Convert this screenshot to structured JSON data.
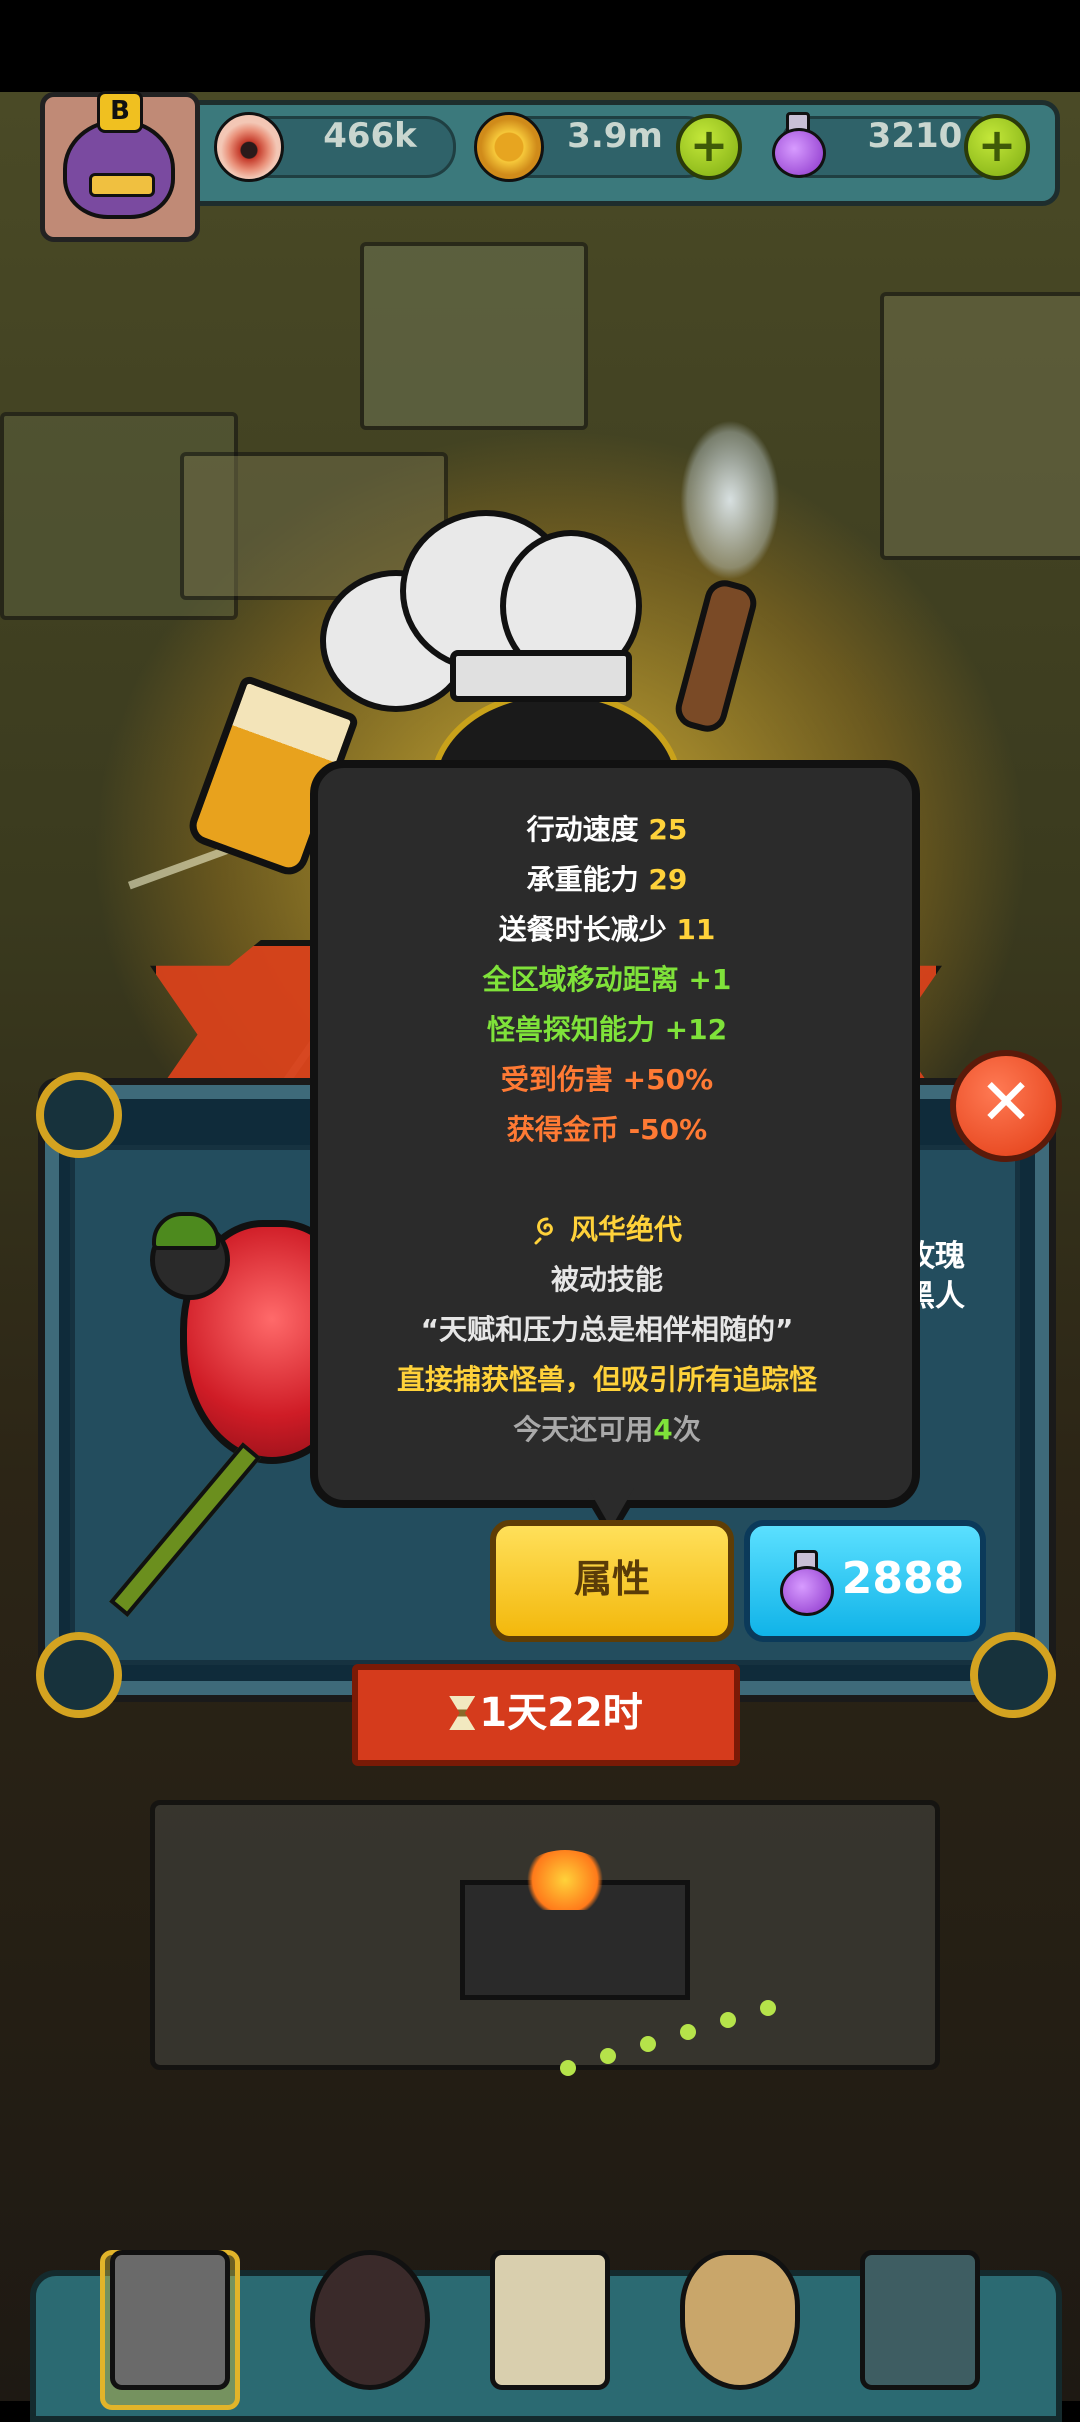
{
  "hud": {
    "eyeballs": "466k",
    "coins": "3.9m",
    "potions": "3210",
    "avatar_letter": "B",
    "plus_symbol": "+"
  },
  "popup": {
    "stats": [
      {
        "label": "行动速度",
        "value": "25"
      },
      {
        "label": "承重能力",
        "value": "29"
      },
      {
        "label": "送餐时长减少",
        "value": "11"
      }
    ],
    "bonuses": [
      {
        "label": "全区域移动距离",
        "value": "+1"
      },
      {
        "label": "怪兽探知能力",
        "value": "+12"
      }
    ],
    "penalties": [
      {
        "label": "受到伤害",
        "value": "+50%"
      },
      {
        "label": "获得金币",
        "value": "-50%"
      }
    ],
    "skill_name": "风华绝代",
    "skill_type": "被动技能",
    "skill_quote": "“天赋和压力总是相伴相随的”",
    "skill_effect": "直接捕获怪兽，但吸引所有追踪怪",
    "uses_prefix": "今天还可用",
    "uses_count": "4",
    "uses_suffix": "次"
  },
  "character": {
    "name_line1": "玫瑰",
    "name_line2": "黑人"
  },
  "buttons": {
    "attributes_label": "属性",
    "price": "2888",
    "close_symbol": "✕"
  },
  "timer": {
    "remaining": "1天22时"
  },
  "colors": {
    "stat_value": "#ffd23a",
    "bonus": "#7fe23a",
    "penalty": "#ff7a34",
    "skill_effect": "#ffd23a"
  }
}
